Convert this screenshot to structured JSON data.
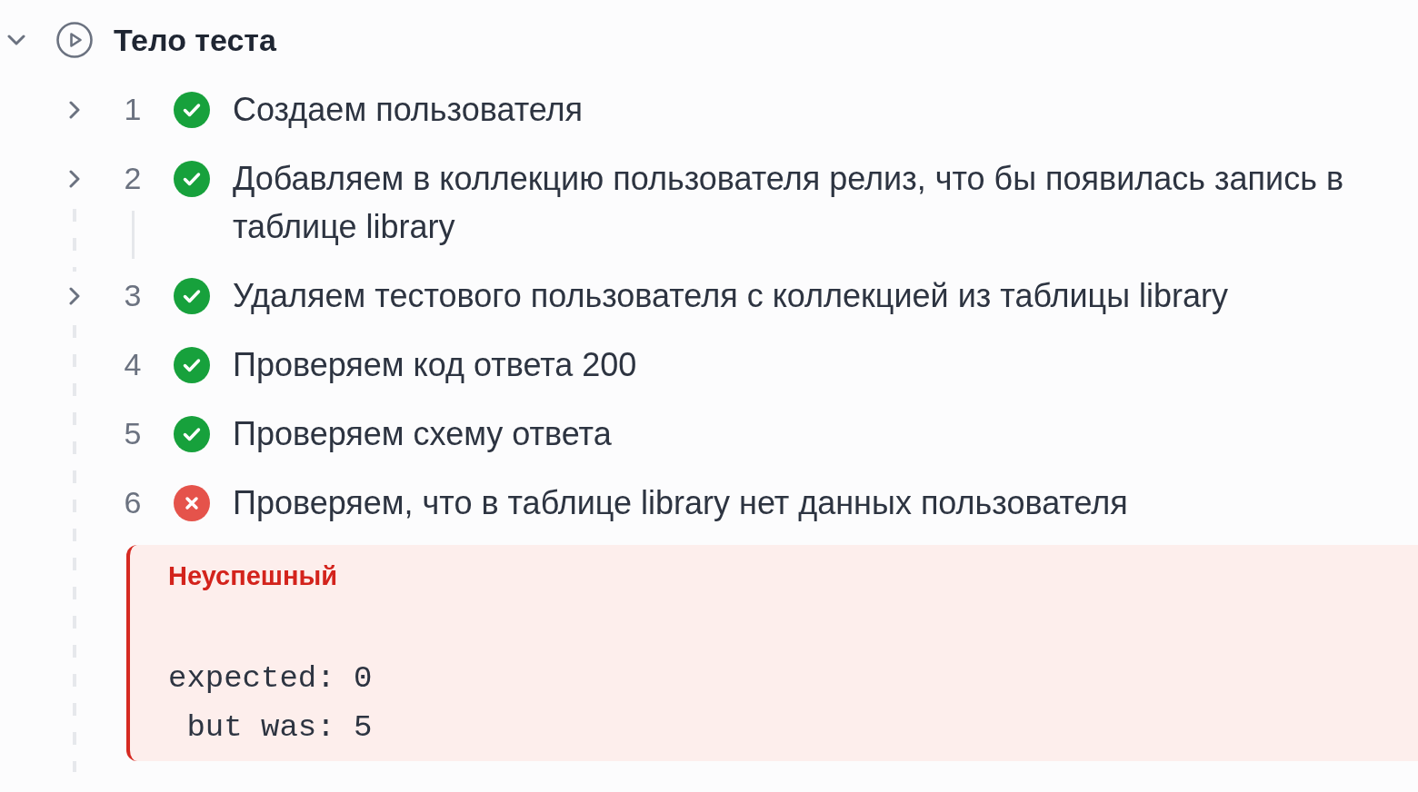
{
  "section": {
    "title": "Тело теста",
    "expanded": true
  },
  "steps": [
    {
      "number": "1",
      "text": "Создаем пользователя",
      "passed": true,
      "expandable": true,
      "expanded": false
    },
    {
      "number": "2",
      "text": "Добавляем в коллекцию пользователя релиз, что бы появилась запись в таблице library",
      "passed": true,
      "expandable": true,
      "expanded": false
    },
    {
      "number": "3",
      "text": "Удаляем тестового пользователя с коллекцией из таблицы library",
      "passed": true,
      "expandable": true,
      "expanded": false
    },
    {
      "number": "4",
      "text": "Проверяем код ответа 200",
      "passed": true,
      "expandable": false
    },
    {
      "number": "5",
      "text": "Проверяем схему ответа",
      "passed": true,
      "expandable": false
    },
    {
      "number": "6",
      "text": "Проверяем, что в таблице library нет данных пользователя",
      "passed": false,
      "expandable": false,
      "error": {
        "status": "Неуспешный",
        "message": "expected: 0\n but was: 5"
      }
    }
  ]
}
